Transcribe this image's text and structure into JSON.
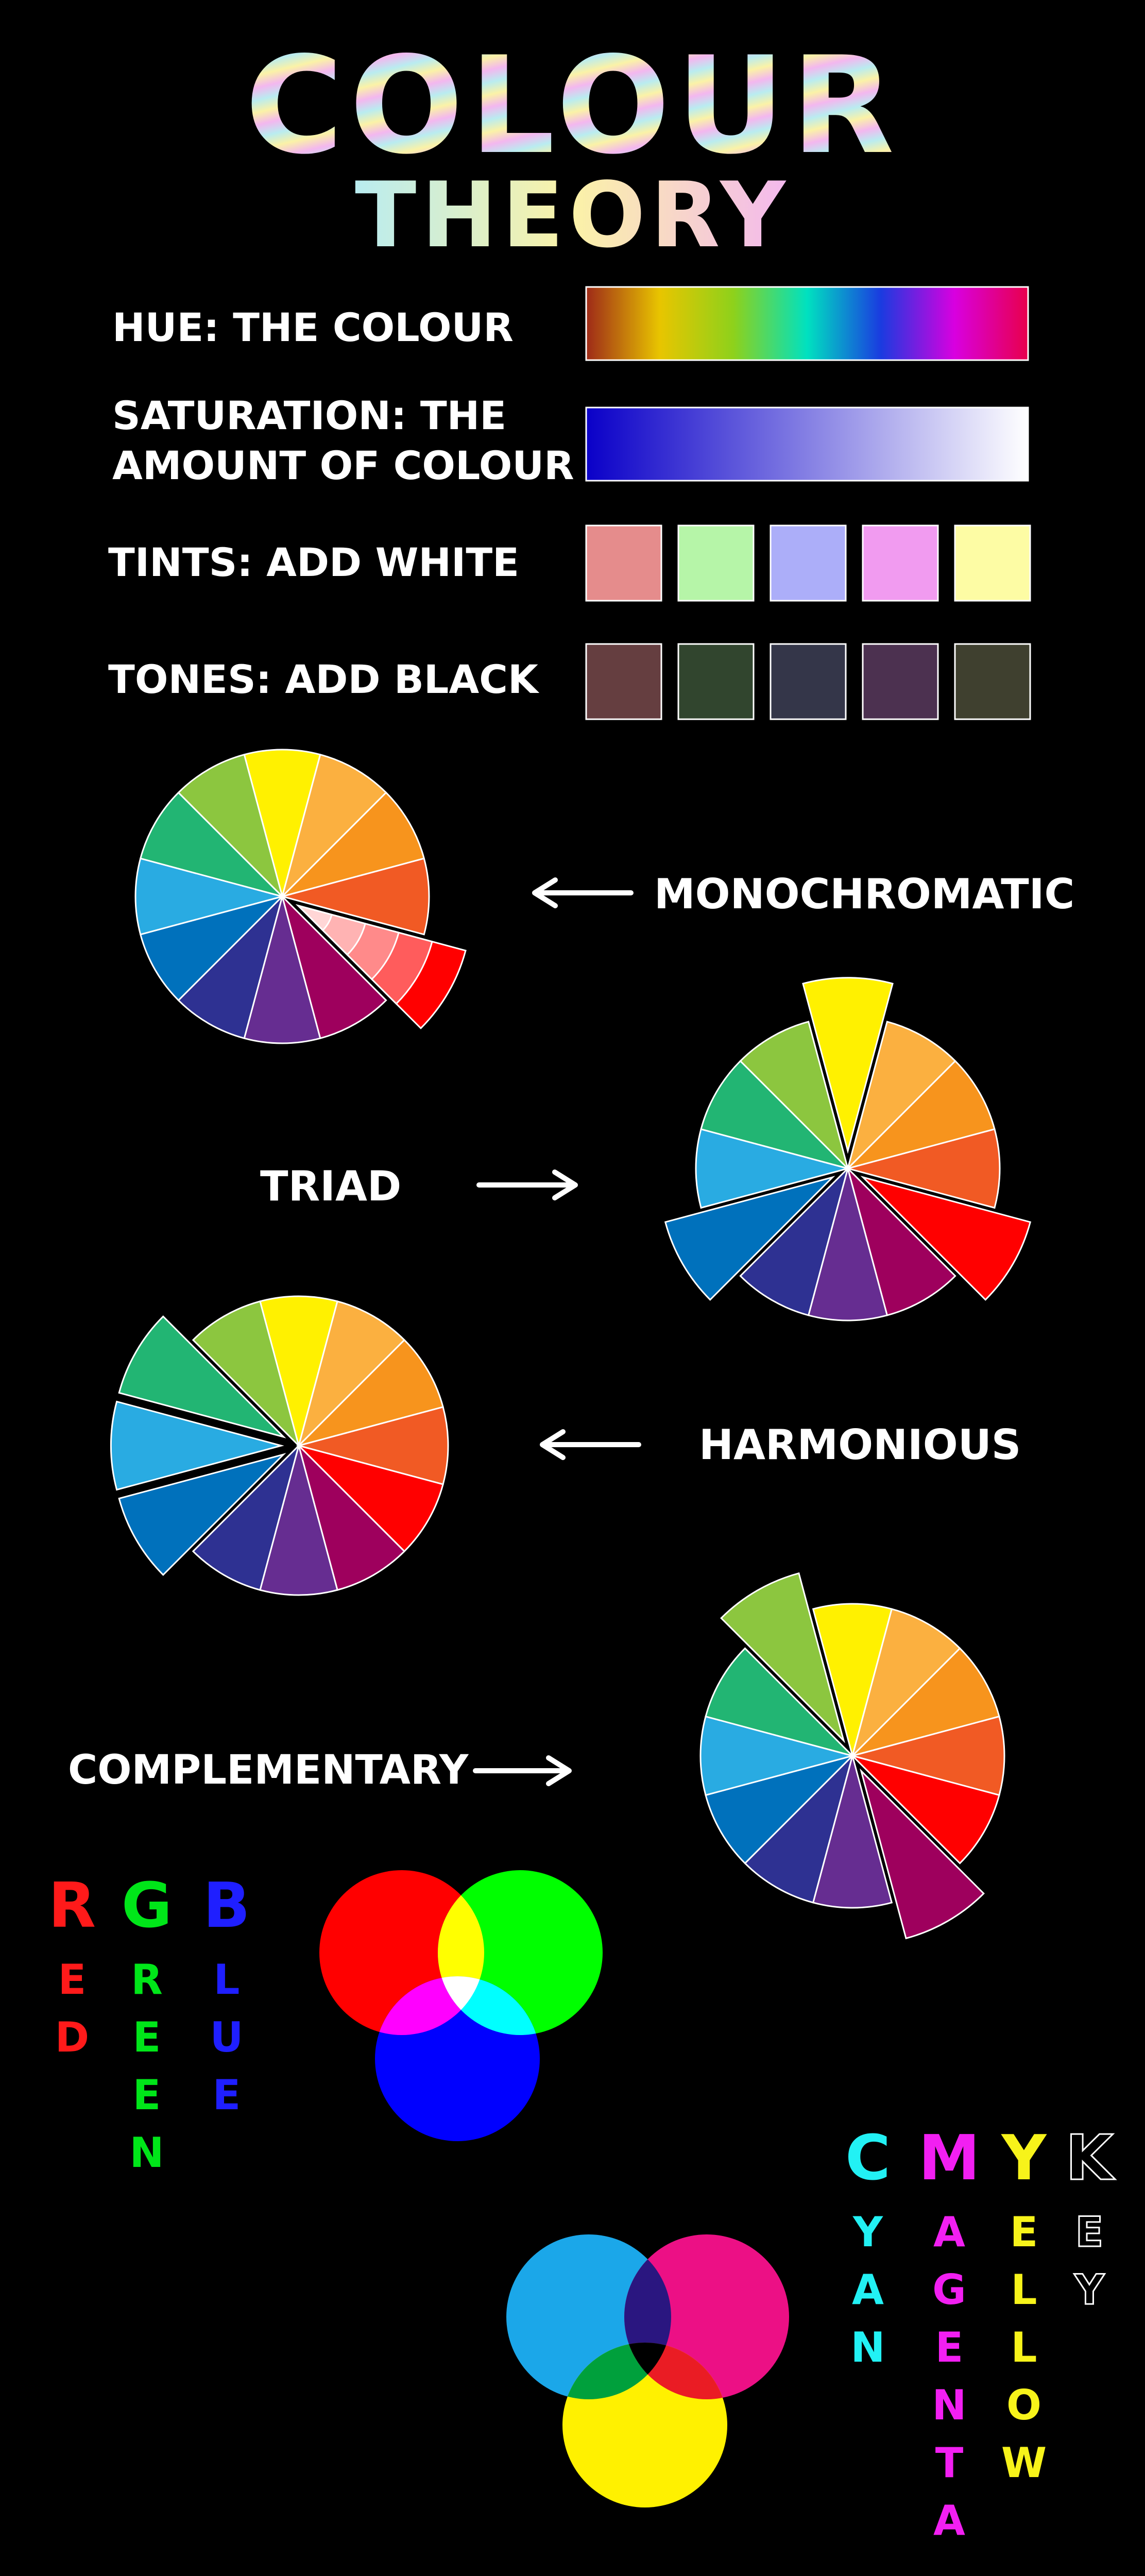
{
  "title": {
    "line1": "COLOUR",
    "line2": "THEORY",
    "colours": [
      "#b9ecf0",
      "#fbf2a7",
      "#f3b7ef"
    ]
  },
  "properties": {
    "hue": {
      "label": "HUE: THE COLOUR",
      "gradient": [
        "#9e2a18",
        "#e8c500",
        "#8ed11b",
        "#00e1c0",
        "#1a3be0",
        "#d800e0",
        "#e8004c"
      ]
    },
    "saturation": {
      "line1": "SATURATION: THE",
      "line2": "AMOUNT OF COLOUR",
      "gradient": [
        "#0a00c8",
        "#ffffff"
      ]
    },
    "tints": {
      "label": "TINTS: ADD WHITE",
      "swatches": [
        "#e58c8c",
        "#b6f5a8",
        "#acaef9",
        "#f19bf0",
        "#fdfca4"
      ]
    },
    "tones": {
      "label": "TONES: ADD BLACK",
      "swatches": [
        "#653e40",
        "#31452e",
        "#343649",
        "#4c3150",
        "#3f402f"
      ]
    }
  },
  "wheel": {
    "colours": [
      "#fff100",
      "#fbb040",
      "#f7941d",
      "#f15a24",
      "#ff0000",
      "#9e005d",
      "#662d91",
      "#2e3192",
      "#0071bc",
      "#29abe2",
      "#22b573",
      "#8cc63f"
    ],
    "monochromatic_shades": [
      "#ffd6d6",
      "#ffb3b3",
      "#ff8a8a",
      "#ff5c5c",
      "#ff0000"
    ]
  },
  "schemes": {
    "monochromatic": {
      "label": "MONOCHROMATIC",
      "highlight": [
        4
      ]
    },
    "triad": {
      "label": "TRIAD",
      "highlight": [
        0,
        4,
        8
      ]
    },
    "harmonious": {
      "label": "HARMONIOUS",
      "highlight": [
        8,
        9,
        10
      ]
    },
    "complementary": {
      "label": "COMPLEMENTARY",
      "highlight": [
        5,
        11
      ]
    }
  },
  "rgb": {
    "words": [
      {
        "text": "RED",
        "colour": "#ff1a1a"
      },
      {
        "text": "GREEN",
        "colour": "#00e619"
      },
      {
        "text": "BLUE",
        "colour": "#1f1fff"
      }
    ],
    "circles": [
      "#ff0000",
      "#00ff00",
      "#0000ff"
    ],
    "overlaps": {
      "rg": "#ffff00",
      "rb": "#ff00ff",
      "gb": "#00ffff",
      "rgb": "#ffffff"
    }
  },
  "cmyk": {
    "words": [
      {
        "text": "CYAN",
        "colour": "#22f1f4"
      },
      {
        "text": "MAGENTA",
        "colour": "#f21ff2"
      },
      {
        "text": "YELLOW",
        "colour": "#f7f31a"
      },
      {
        "text": "KEY",
        "colour": "#000000"
      }
    ],
    "circles": [
      "#1ba7e9",
      "#ec1085",
      "#fff100"
    ],
    "overlaps": {
      "cm": "#2a1680",
      "cy": "#00a03c",
      "my": "#ea1c24",
      "cmy": "#000000"
    }
  }
}
